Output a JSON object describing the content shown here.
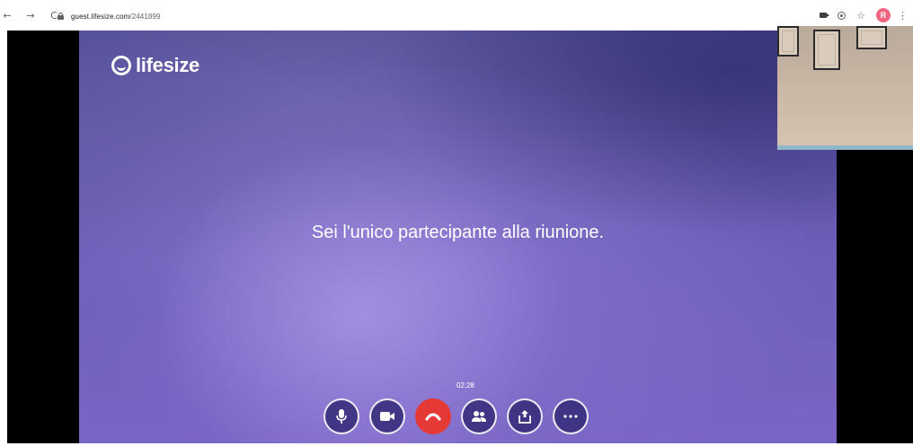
{
  "browser": {
    "back_icon": "←",
    "forward_icon": "→",
    "reload_icon": "C",
    "url_host": "guest.lifesize.com",
    "url_path": "/2441899",
    "star_icon": "☆",
    "avatar_letter": "R",
    "menu_icon": "⋮"
  },
  "app": {
    "logo_text": "lifesize",
    "message": "Sei l'unico partecipante alla riunione.",
    "timer": "02:28",
    "controls": [
      {
        "name": "microphone",
        "icon": "mic-icon"
      },
      {
        "name": "camera",
        "icon": "video-camera-icon"
      },
      {
        "name": "hang-up",
        "icon": "phone-hangup-icon"
      },
      {
        "name": "participants",
        "icon": "people-icon"
      },
      {
        "name": "share",
        "icon": "share-screen-icon"
      },
      {
        "name": "more",
        "icon": "more-dots-icon"
      }
    ]
  },
  "colors": {
    "hangup": "#e53935",
    "avatar": "#f16581",
    "stage_primary": "#6d5fb8"
  }
}
